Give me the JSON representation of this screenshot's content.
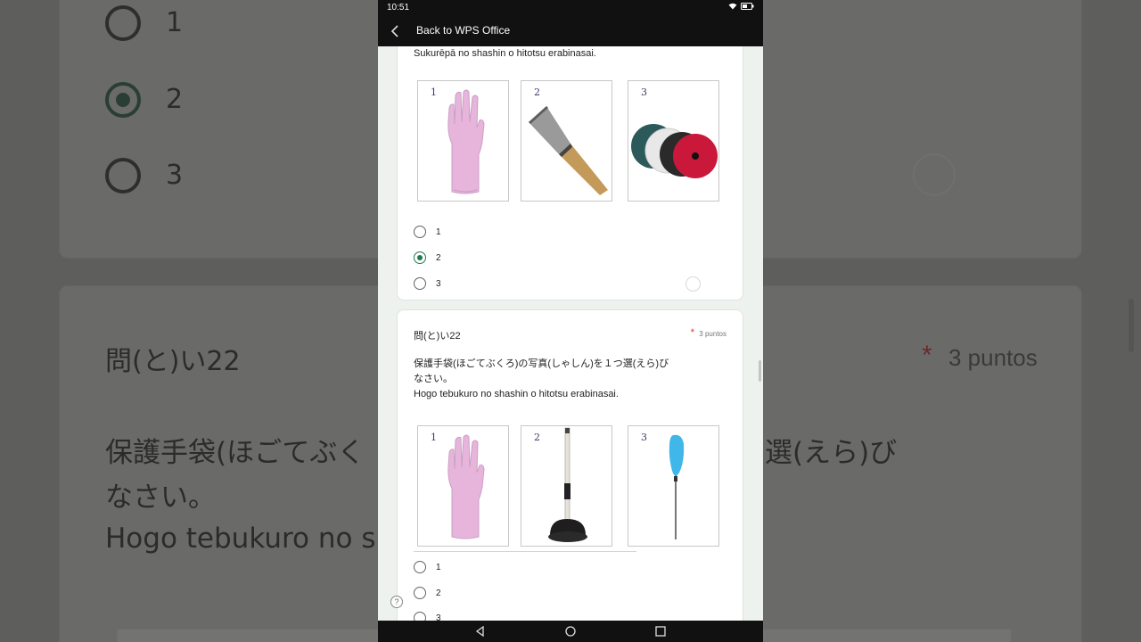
{
  "status_bar": {
    "time": "10:51"
  },
  "app_bar": {
    "back_label": "Back to WPS Office"
  },
  "question21": {
    "instruction": "Sukurēpā no shashin o hitotsu erabinasai.",
    "image_numbers": [
      "1",
      "2",
      "3"
    ],
    "image_icons": [
      "pink-glove-icon",
      "scraper-icon",
      "floor-pads-icon"
    ],
    "options": [
      {
        "label": "1",
        "selected": false
      },
      {
        "label": "2",
        "selected": true
      },
      {
        "label": "3",
        "selected": false
      }
    ]
  },
  "question22": {
    "title": "問(と)い22",
    "required_mark": "*",
    "points": "3 puntos",
    "text_jp_line1": "保護手袋(ほごてぶくろ)の写真(しゃしん)を１つ選(えら)び",
    "text_jp_line2": "なさい。",
    "text_romaji": "Hogo tebukuro no shashin o hitotsu erabinasai.",
    "image_numbers": [
      "1",
      "2",
      "3"
    ],
    "image_icons": [
      "pink-glove-icon",
      "plunger-icon",
      "duster-icon"
    ],
    "options": [
      {
        "label": "1",
        "selected": false
      },
      {
        "label": "2",
        "selected": false
      },
      {
        "label": "3",
        "selected": false
      }
    ]
  },
  "help_icon": "?",
  "background": {
    "q21_options": [
      "1",
      "2",
      "3"
    ],
    "q22_title": "問(と)い22",
    "q22_points": "3 puntos",
    "q22_text_line1_left": "保護手袋(ほごてぶく",
    "q22_text_line1_right": "選(えら)び",
    "q22_text_line2": "なさい。",
    "q22_text_line3": "Hogo tebukuro no sh"
  },
  "colors": {
    "accent": "#1e7a4c",
    "required": "#d93025",
    "dark_bar": "#111111"
  }
}
